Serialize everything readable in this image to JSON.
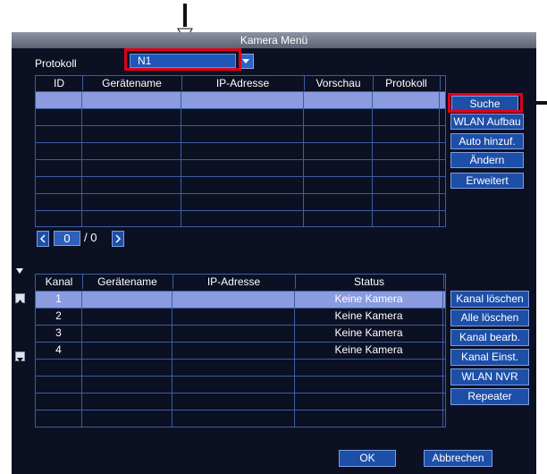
{
  "window": {
    "title": "Kamera Menü"
  },
  "protocol": {
    "label": "Protokoll",
    "value": "N1"
  },
  "camera_table": {
    "headers": [
      "ID",
      "Gerätename",
      "IP-Adresse",
      "Vorschau",
      "Protokoll"
    ],
    "rows": 8,
    "selected_row": 0
  },
  "side_buttons_top": [
    "Suche",
    "WLAN Aufbau",
    "Auto hinzuf.",
    "Ändern",
    "Erweitert"
  ],
  "pager": {
    "page": "0",
    "total": "/ 0"
  },
  "channel_table": {
    "headers": [
      "Kanal",
      "Gerätename",
      "IP-Adresse",
      "Status"
    ],
    "rows": [
      {
        "kanal": "1",
        "status": "Keine Kamera"
      },
      {
        "kanal": "2",
        "status": "Keine Kamera"
      },
      {
        "kanal": "3",
        "status": "Keine Kamera"
      },
      {
        "kanal": "4",
        "status": "Keine Kamera"
      }
    ],
    "selected_row": 0
  },
  "side_buttons_bottom": [
    "Kanal löschen",
    "Alle löschen",
    "Kanal bearb.",
    "Kanal Einst.",
    "WLAN NVR",
    "Repeater"
  ],
  "footer": {
    "ok": "OK",
    "cancel": "Abbrechen"
  }
}
